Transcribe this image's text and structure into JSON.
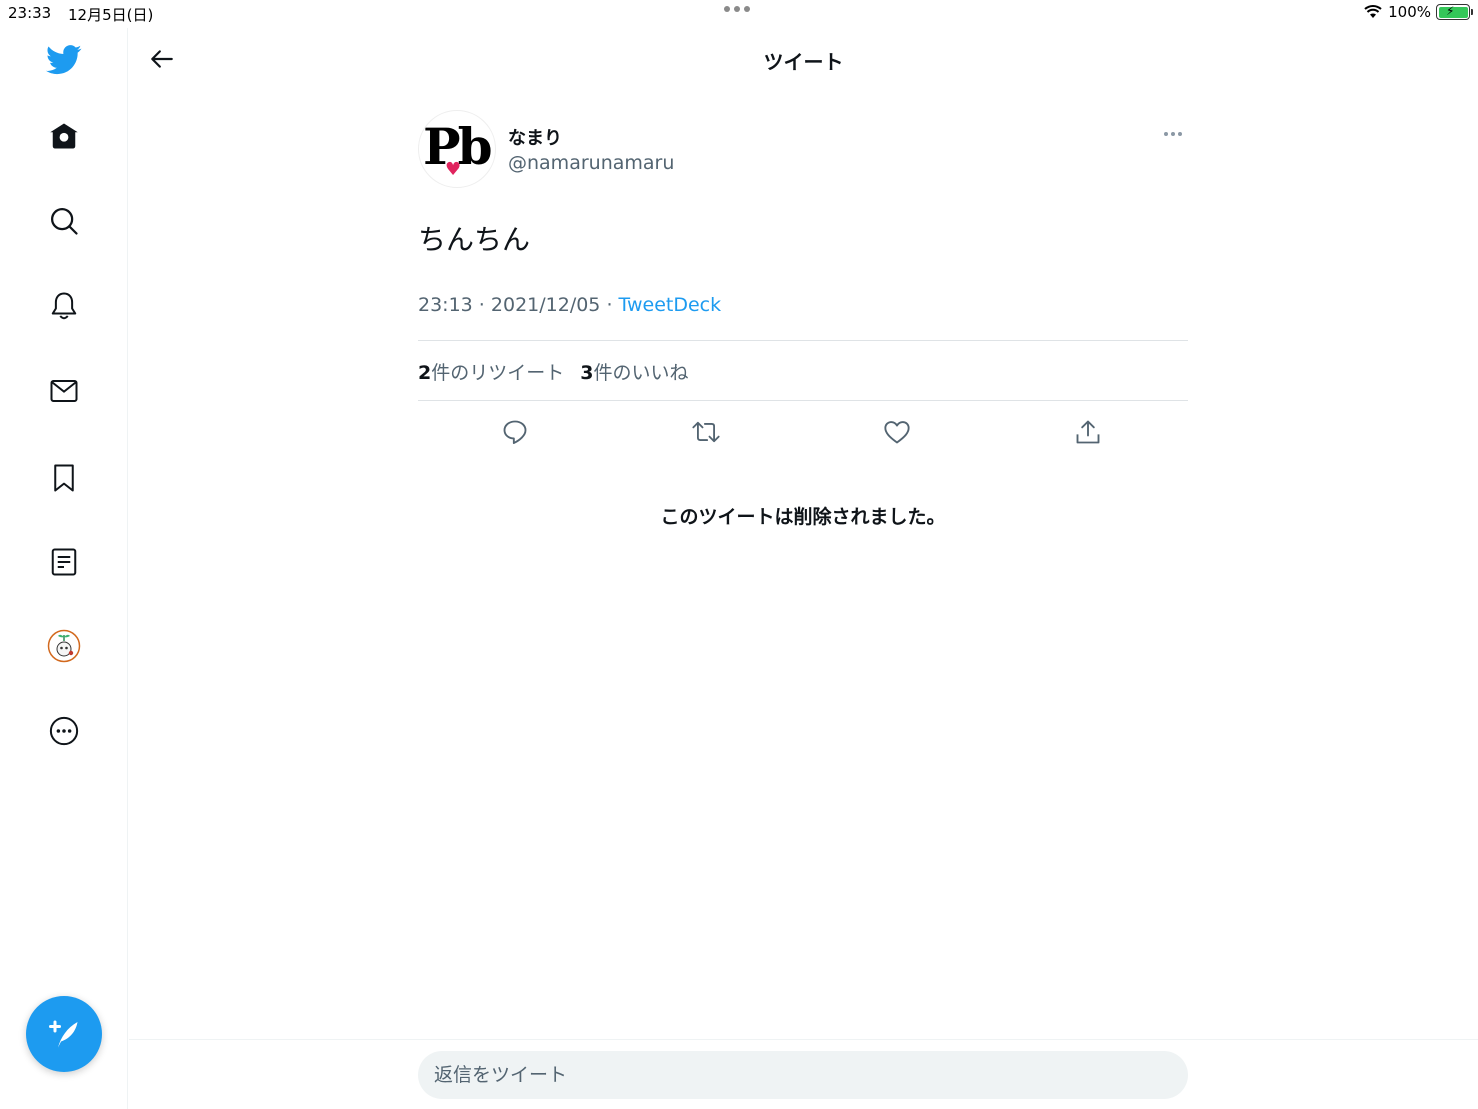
{
  "status_bar": {
    "time": "23:33",
    "date": "12月5日(日)",
    "battery": "100%"
  },
  "header": {
    "title": "ツイート"
  },
  "tweet": {
    "display_name": "なまり",
    "handle": "@namarunamaru",
    "avatar_text": "Pb",
    "text": "ちんちん",
    "time": "23:13",
    "separator": " · ",
    "date": "2021/12/05",
    "source": "TweetDeck",
    "retweet_count": "2",
    "retweet_label": "件のリツイート",
    "like_count": "3",
    "like_label": "件のいいね",
    "deleted_message": "このツイートは削除されました。"
  },
  "reply": {
    "placeholder": "返信をツイート"
  },
  "colors": {
    "accent": "#1d9bf0",
    "text_primary": "#0f1419",
    "text_secondary": "#536471",
    "divider": "#dfe3e6"
  },
  "icons": {
    "sidebar": [
      "twitter-logo-icon",
      "home-icon",
      "search-icon",
      "bell-icon",
      "mail-icon",
      "bookmark-icon",
      "list-icon",
      "profile-avatar-icon",
      "more-circle-icon"
    ],
    "actions": [
      "reply-icon",
      "retweet-icon",
      "like-icon",
      "share-icon"
    ]
  }
}
